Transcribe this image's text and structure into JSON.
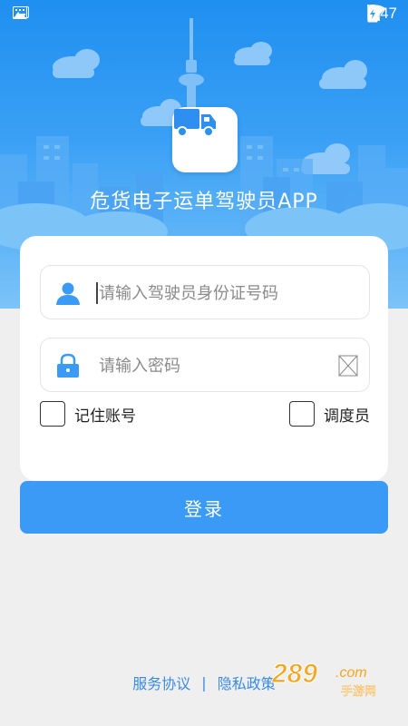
{
  "statusbar": {
    "time": "4:47",
    "icons": [
      "keyboard-icon",
      "image-icon",
      "wifi-icon",
      "no-sim-icon",
      "battery-charging-icon"
    ]
  },
  "app": {
    "title": "危货电子运单驾驶员APP",
    "logo_icon": "truck-icon"
  },
  "form": {
    "id_placeholder": "请输入驾驶员身份证号码",
    "id_value": "",
    "password_placeholder": "请输入密码",
    "password_value": "",
    "remember_label": "记住账号",
    "remember_checked": false,
    "dispatcher_label": "调度员",
    "dispatcher_checked": false
  },
  "login_label": "登录",
  "footer": {
    "service_label": "服务协议",
    "separator": "|",
    "privacy_label": "隐私政策"
  },
  "watermark": "289.com 手游网",
  "colors": {
    "primary": "#3a9af5",
    "link": "#3a8be5",
    "background": "#efefef"
  }
}
